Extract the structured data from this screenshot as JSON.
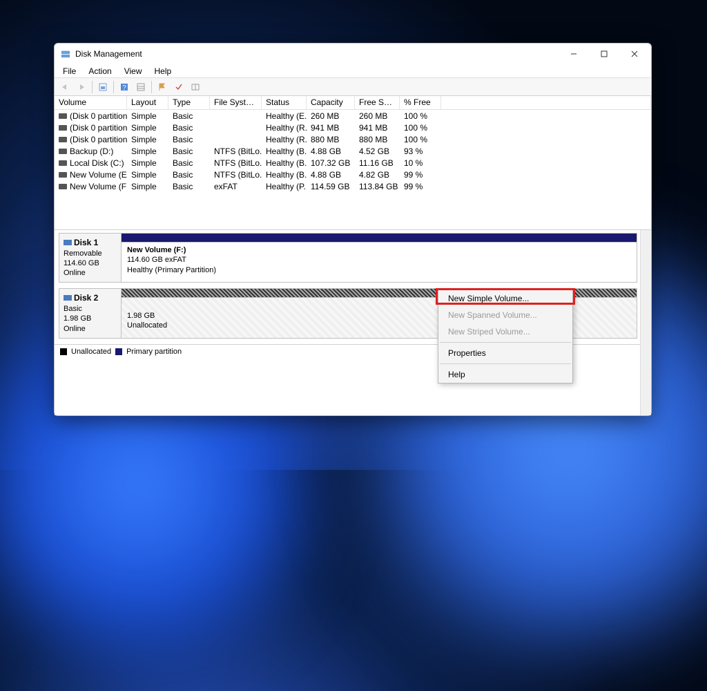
{
  "window": {
    "title": "Disk Management"
  },
  "menubar": [
    "File",
    "Action",
    "View",
    "Help"
  ],
  "columns": {
    "volume": "Volume",
    "layout": "Layout",
    "type": "Type",
    "filesystem": "File System",
    "status": "Status",
    "capacity": "Capacity",
    "free": "Free Sp...",
    "pctfree": "% Free"
  },
  "volumes": [
    {
      "name": "(Disk 0 partition 1)",
      "layout": "Simple",
      "type": "Basic",
      "fs": "",
      "status": "Healthy (E...",
      "cap": "260 MB",
      "free": "260 MB",
      "pct": "100 %"
    },
    {
      "name": "(Disk 0 partition 4)",
      "layout": "Simple",
      "type": "Basic",
      "fs": "",
      "status": "Healthy (R...",
      "cap": "941 MB",
      "free": "941 MB",
      "pct": "100 %"
    },
    {
      "name": "(Disk 0 partition 8)",
      "layout": "Simple",
      "type": "Basic",
      "fs": "",
      "status": "Healthy (R...",
      "cap": "880 MB",
      "free": "880 MB",
      "pct": "100 %"
    },
    {
      "name": "Backup (D:)",
      "layout": "Simple",
      "type": "Basic",
      "fs": "NTFS (BitLo...",
      "status": "Healthy (B...",
      "cap": "4.88 GB",
      "free": "4.52 GB",
      "pct": "93 %"
    },
    {
      "name": "Local Disk (C:)",
      "layout": "Simple",
      "type": "Basic",
      "fs": "NTFS (BitLo...",
      "status": "Healthy (B...",
      "cap": "107.32 GB",
      "free": "11.16 GB",
      "pct": "10 %"
    },
    {
      "name": "New Volume (E:)",
      "layout": "Simple",
      "type": "Basic",
      "fs": "NTFS (BitLo...",
      "status": "Healthy (B...",
      "cap": "4.88 GB",
      "free": "4.82 GB",
      "pct": "99 %"
    },
    {
      "name": "New Volume (F:)",
      "layout": "Simple",
      "type": "Basic",
      "fs": "exFAT",
      "status": "Healthy (P...",
      "cap": "114.59 GB",
      "free": "113.84 GB",
      "pct": "99 %"
    }
  ],
  "disks": [
    {
      "name": "Disk 1",
      "media": "Removable",
      "size": "114.60 GB",
      "status": "Online",
      "vol_title": "New Volume  (F:)",
      "vol_line1": "114.60 GB exFAT",
      "vol_line2": "Healthy (Primary Partition)",
      "bar": "primary"
    },
    {
      "name": "Disk 2",
      "media": "Basic",
      "size": "1.98 GB",
      "status": "Online",
      "vol_title": "",
      "vol_line1": "1.98 GB",
      "vol_line2": "Unallocated",
      "bar": "unalloc"
    }
  ],
  "legend": {
    "unallocated": "Unallocated",
    "primary": "Primary partition"
  },
  "context_menu": {
    "items": [
      "New Simple Volume...",
      "New Spanned Volume...",
      "New Striped Volume...",
      "Properties",
      "Help"
    ]
  }
}
